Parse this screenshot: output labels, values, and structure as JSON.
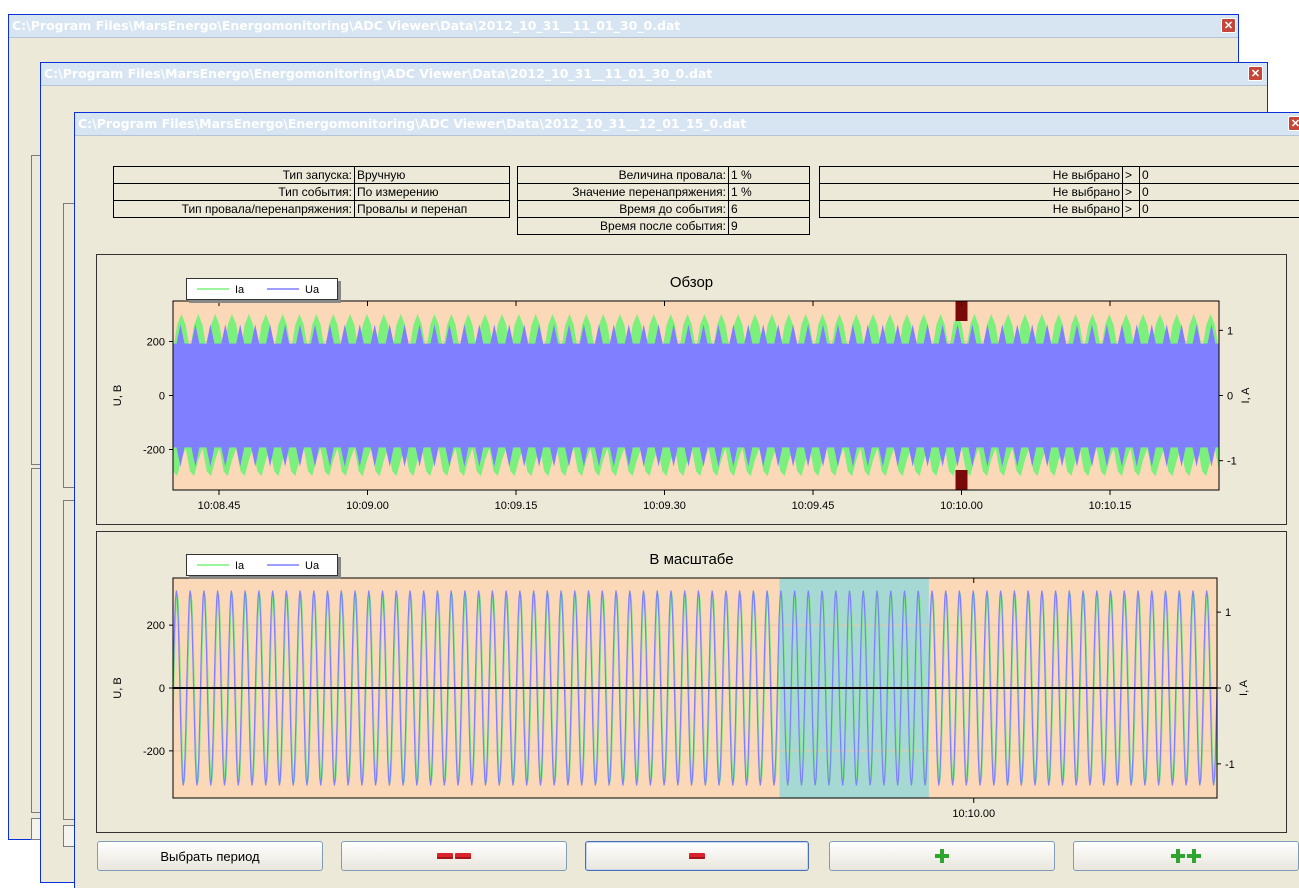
{
  "windows": [
    {
      "title": "C:\\Program Files\\MarsEnergo\\Energomonitoring\\ADC Viewer\\Data\\2012_10_31__11_01_30_0.dat",
      "close": "✕"
    },
    {
      "title": "C:\\Program Files\\MarsEnergo\\Energomonitoring\\ADC Viewer\\Data\\2012_10_31__11_01_30_0.dat",
      "close": "✕"
    },
    {
      "title": "C:\\Program Files\\MarsEnergo\\Energomonitoring\\ADC Viewer\\Data\\2012_10_31__12_01_15_0.dat",
      "close": "✕"
    }
  ],
  "params_left": [
    {
      "label": "Тип запуска:",
      "value": "Вручную"
    },
    {
      "label": "Тип события:",
      "value": "По измерению"
    },
    {
      "label": "Тип провала/перенапряжения:",
      "value": "Провалы  и перенап"
    }
  ],
  "params_middle": [
    {
      "label": "Величина провала:",
      "value": "1 %"
    },
    {
      "label": "Значение перенапряжения:",
      "value": "1 %"
    },
    {
      "label": "Время до события:",
      "value": "6"
    },
    {
      "label": "Время после события:",
      "value": "9"
    }
  ],
  "params_right": [
    {
      "label": "Не выбрано",
      "op": ">",
      "value": "0"
    },
    {
      "label": "Не выбрано",
      "op": ">",
      "value": "0"
    },
    {
      "label": "Не выбрано",
      "op": ">",
      "value": "0"
    }
  ],
  "colors": {
    "plot_bg": "#fbd9b8",
    "ia": "#7cf07c",
    "ua": "#7f7fff",
    "highlight": "#a6d9d3",
    "marker": "#7a0a0a"
  },
  "chart_data": [
    {
      "type": "line",
      "title": "Обзор",
      "ylabel": "U, B",
      "y2label": "I, A",
      "ylim": [
        -350,
        350
      ],
      "y2lim": [
        -1.45,
        1.45
      ],
      "yticks": [
        {
          "v": 200,
          "label": "200"
        },
        {
          "v": 0,
          "label": "0"
        },
        {
          "v": -200,
          "label": "-200"
        }
      ],
      "y2ticks": [
        {
          "v": 1,
          "label": "1"
        },
        {
          "v": 0,
          "label": "0"
        },
        {
          "v": -1,
          "label": "-1"
        }
      ],
      "xticks": [
        "10:08.45",
        "10:09.00",
        "10:09.15",
        "10:09.30",
        "10:09.45",
        "10:10.00",
        "10:10.15"
      ],
      "series": [
        {
          "name": "Ia",
          "color": "#7cf07c",
          "amplitude": 1.25
        },
        {
          "name": "Ua",
          "color": "#7f7fff",
          "amplitude": 310
        }
      ],
      "marker_time": "10:10.00"
    },
    {
      "type": "line",
      "title": "В масштабе",
      "ylabel": "U, B",
      "y2label": "I, A",
      "ylim": [
        -350,
        350
      ],
      "y2lim": [
        -1.45,
        1.45
      ],
      "yticks": [
        {
          "v": 200,
          "label": "200"
        },
        {
          "v": 0,
          "label": "0"
        },
        {
          "v": -200,
          "label": "-200"
        }
      ],
      "y2ticks": [
        {
          "v": 1,
          "label": "1"
        },
        {
          "v": 0,
          "label": "0"
        },
        {
          "v": -1,
          "label": "-1"
        }
      ],
      "xticks": [
        "10:10.00"
      ],
      "series": [
        {
          "name": "Ia",
          "color": "#7cf07c",
          "amplitude": 1.25
        },
        {
          "name": "Ua",
          "color": "#7f7fff",
          "amplitude": 310
        }
      ],
      "highlight": true
    }
  ],
  "buttons": {
    "select_period": "Выбрать период",
    "zoom_out_2": "zoom-out-2",
    "zoom_out_1": "zoom-out-1",
    "zoom_in_1": "zoom-in-1",
    "zoom_in_2": "zoom-in-2"
  }
}
